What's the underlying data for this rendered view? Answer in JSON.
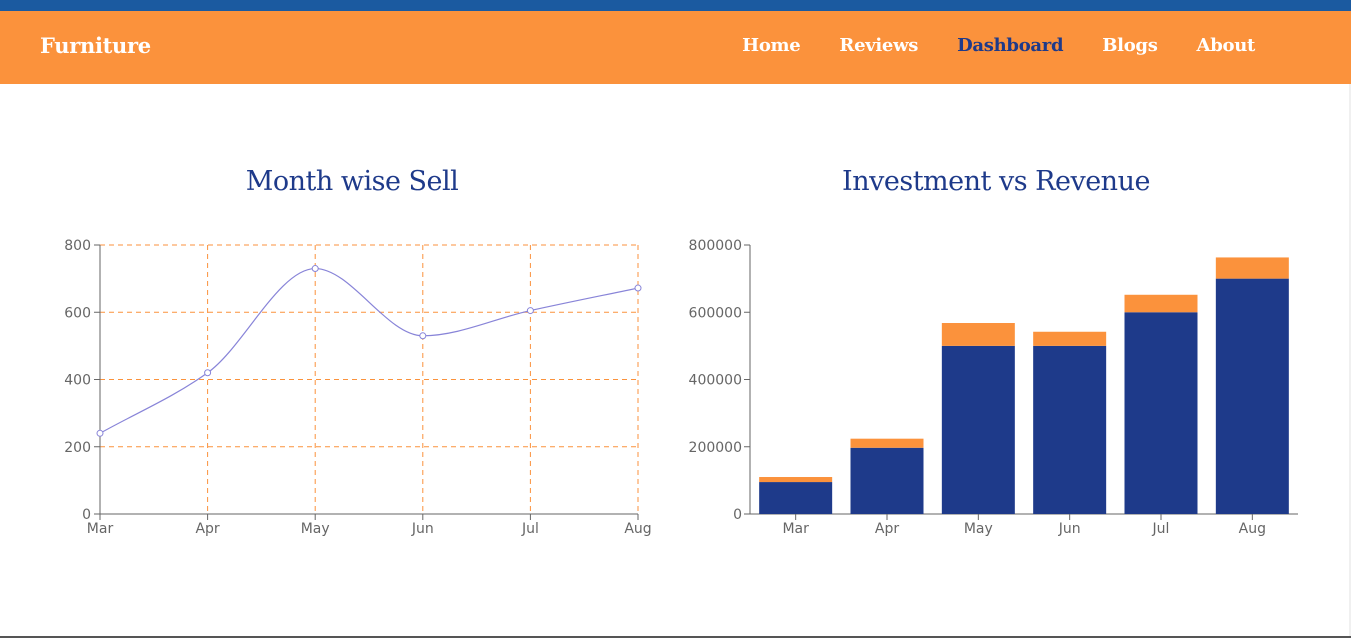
{
  "navbar": {
    "brand": "Furniture",
    "links": [
      {
        "label": "Home",
        "active": false
      },
      {
        "label": "Reviews",
        "active": false
      },
      {
        "label": "Dashboard",
        "active": true
      },
      {
        "label": "Blogs",
        "active": false
      },
      {
        "label": "About",
        "active": false
      }
    ]
  },
  "colors": {
    "navbar": "#fb923c",
    "topstrip": "#1b5aa0",
    "title": "#1e3a8a",
    "line": "#8884d8",
    "grid": "#fb923c",
    "investment": "#1e3a8a",
    "revenue": "#fb923c"
  },
  "chart_data": [
    {
      "type": "line",
      "title": "Month wise Sell",
      "categories": [
        "Mar",
        "Apr",
        "May",
        "Jun",
        "Jul",
        "Aug"
      ],
      "series": [
        {
          "values": [
            240,
            420,
            730,
            530,
            605,
            672
          ]
        }
      ],
      "yticks": [
        0,
        200,
        400,
        600,
        800
      ],
      "ylim": [
        0,
        800
      ],
      "grid": true,
      "curve": "monotone"
    },
    {
      "type": "bar",
      "stacked": true,
      "title": "Investment vs Revenue",
      "categories": [
        "Mar",
        "Apr",
        "May",
        "Jun",
        "Jul",
        "Aug"
      ],
      "series": [
        {
          "values": [
            95000,
            197000,
            500000,
            500000,
            600000,
            700000
          ]
        },
        {
          "values": [
            15000,
            27000,
            68000,
            42000,
            52000,
            63000
          ]
        }
      ],
      "yticks": [
        0,
        200000,
        400000,
        600000,
        800000
      ],
      "ylim": [
        0,
        800000
      ],
      "grid": false
    }
  ]
}
